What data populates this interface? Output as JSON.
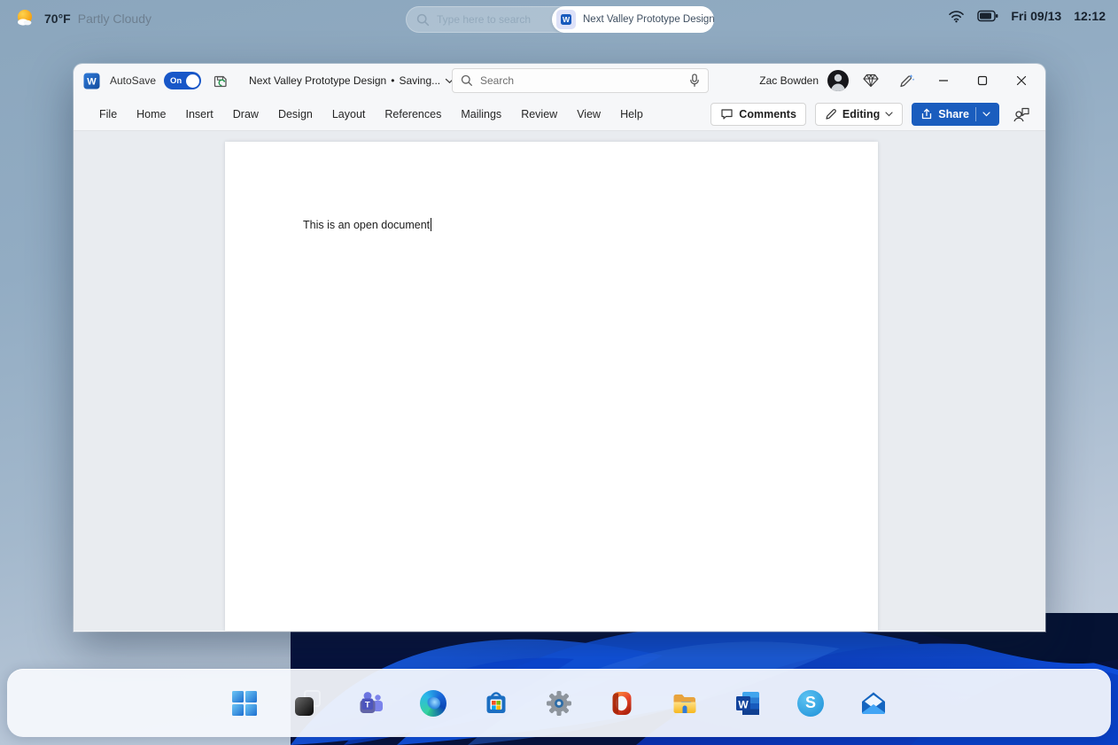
{
  "topbar": {
    "weather": {
      "temp": "70°F",
      "condition": "Partly Cloudy"
    },
    "search": {
      "placeholder": "Type here to search"
    },
    "running_app": {
      "label": "Next Valley Prototype Design"
    },
    "clock": {
      "date": "Fri 09/13",
      "time": "12:12"
    }
  },
  "window": {
    "titlebar": {
      "autosave_label": "AutoSave",
      "autosave_state": "On",
      "doc_title": "Next Valley Prototype Design",
      "separator": "•",
      "doc_status": "Saving...",
      "search_placeholder": "Search",
      "user_name": "Zac Bowden"
    },
    "ribbon": {
      "tabs": [
        "File",
        "Home",
        "Insert",
        "Draw",
        "Design",
        "Layout",
        "References",
        "Mailings",
        "Review",
        "View",
        "Help"
      ],
      "comments_label": "Comments",
      "editing_label": "Editing",
      "share_label": "Share"
    },
    "document": {
      "text": "This is an open document"
    }
  },
  "taskbar": {
    "icons": [
      "start",
      "task-view",
      "teams",
      "edge",
      "store",
      "settings",
      "office",
      "file-explorer",
      "word",
      "skype",
      "mail"
    ]
  },
  "colors": {
    "accent_blue": "#1a5dbe",
    "toggle_blue": "#1857c8",
    "taskbar_bg": "#f4f8fd",
    "bloom_blue": "#0d46d4"
  }
}
